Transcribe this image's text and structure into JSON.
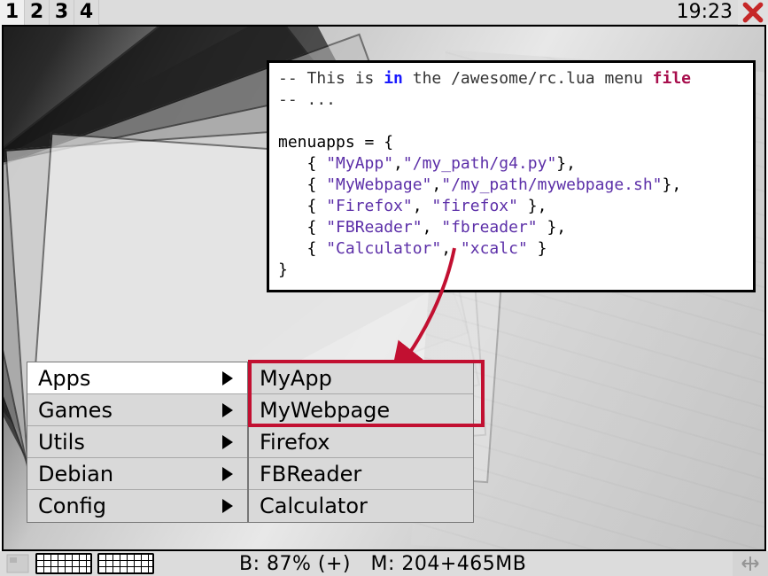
{
  "taskbar": {
    "tags": [
      "1",
      "2",
      "3",
      "4"
    ],
    "active_tag_index": 0,
    "clock": "19:23"
  },
  "code": {
    "c1a": "-- This is ",
    "c1kw": "in",
    "c1b": " the /awesome/rc.lua menu ",
    "c1key": "file",
    "c2": "-- ...",
    "blank": "",
    "l1": "menuapps = {",
    "s1a": "   { ",
    "s1n": "\"MyApp\"",
    "s1c": ",",
    "s1p": "\"/my_path/g4.py\"",
    "s1e": "},",
    "s2a": "   { ",
    "s2n": "\"MyWebpage\"",
    "s2c": ",",
    "s2p": "\"/my_path/mywebpage.sh\"",
    "s2e": "},",
    "s3a": "   { ",
    "s3n": "\"Firefox\"",
    "s3c": ", ",
    "s3p": "\"firefox\"",
    "s3e": " },",
    "s4a": "   { ",
    "s4n": "\"FBReader\"",
    "s4c": ", ",
    "s4p": "\"fbreader\"",
    "s4e": " },",
    "s5a": "   { ",
    "s5n": "\"Calculator\"",
    "s5c": ", ",
    "s5p": "\"xcalc\"",
    "s5e": " }",
    "end": "}"
  },
  "menu": {
    "items": [
      {
        "label": "Apps"
      },
      {
        "label": "Games"
      },
      {
        "label": "Utils"
      },
      {
        "label": "Debian"
      },
      {
        "label": "Config"
      }
    ],
    "selected_index": 0
  },
  "submenu": {
    "items": [
      {
        "label": "MyApp"
      },
      {
        "label": "MyWebpage"
      },
      {
        "label": "Firefox"
      },
      {
        "label": "FBReader"
      },
      {
        "label": "Calculator"
      }
    ]
  },
  "status": {
    "battery_label": "B: 87% (+)",
    "memory_label": "M: 204+465MB"
  }
}
